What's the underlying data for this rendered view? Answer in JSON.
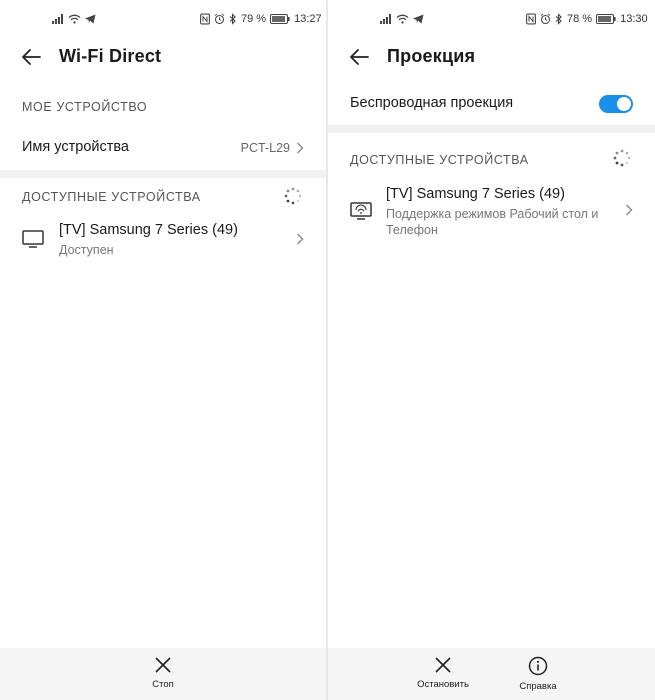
{
  "left": {
    "status": {
      "battery": "79 %",
      "time": "13:27"
    },
    "title": "Wi-Fi Direct",
    "my_device_header": "МОЕ УСТРОЙСТВО",
    "device_name_label": "Имя устройства",
    "device_name_value": "PCT-L29",
    "available_header": "ДОСТУПНЫЕ УСТРОЙСТВА",
    "device": {
      "name": "[TV] Samsung 7 Series (49)",
      "status": "Доступен",
      "icon": "tv-icon"
    },
    "bottom": {
      "stop_label": "Стоп"
    }
  },
  "right": {
    "status": {
      "battery": "78 %",
      "time": "13:30"
    },
    "title": "Проекция",
    "wireless_label": "Беспроводная проекция",
    "wireless_enabled": true,
    "available_header": "ДОСТУПНЫЕ УСТРОЙСТВА",
    "device": {
      "name": "[TV] Samsung 7 Series (49)",
      "desc_line1": "Поддержка режимов Рабочий стол и",
      "desc_line2": "Телефон",
      "icon": "cast-tv-icon"
    },
    "bottom": {
      "stop_label": "Остановить",
      "help_label": "Справка"
    }
  },
  "colors": {
    "accent": "#1a8fea",
    "band": "#f1f1f1",
    "bottom_bar": "#f5f5f5"
  }
}
